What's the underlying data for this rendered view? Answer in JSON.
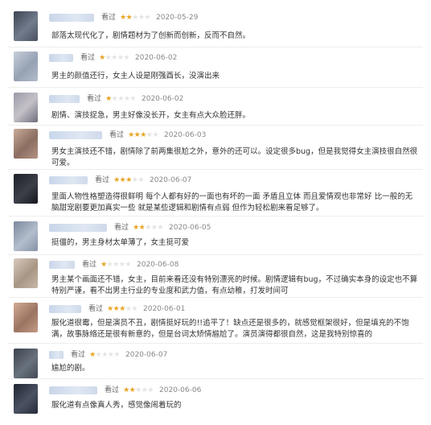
{
  "seen_label": "看过",
  "reviews": [
    {
      "rating": 2,
      "date": "2020-05-29",
      "text": "部落太现代化了，剧情题材为了创新而创新，反而不自然。",
      "avatar_color": "#5f6674"
    },
    {
      "rating": 1,
      "date": "2020-06-02",
      "text": "男主的颜值还行，女主人设是刚强酉长，没演出来",
      "avatar_color": "#a9b3c2"
    },
    {
      "rating": 1,
      "date": "2020-06-02",
      "text": "剧情、演技捉急，男主好像没长开，女主有点大众脸还胖。",
      "avatar_color": "#8c8b95"
    },
    {
      "rating": 3,
      "date": "2020-06-03",
      "text": "男女主演技还不错，剧情除了前两集很尬之外，意外的还可以。设定很多bug，但是我觉得女主演技很自然很可爱。",
      "avatar_color": "#a68a7c"
    },
    {
      "rating": 3,
      "date": "2020-06-07",
      "text": "里面人物性格塑造得很鲜明 每个人都有好的一面也有坏的一面 矛盾且立体 而且爱情观也非常好 比一般的无脑甜宠剧要更加真实一些 就是某些逻辑和剧情有点弱 但作为轻松剧来看足够了。",
      "avatar_color": "#2a2c33"
    },
    {
      "rating": 2,
      "date": "2020-06-05",
      "text": "挺僵的，男主身材太单薄了，女主挺可爱",
      "avatar_color": "#8e9aae"
    },
    {
      "rating": 1,
      "date": "2020-06-08",
      "text": "男主某个画面还不错，女主，目前来看还没有特别漂亮的时候。剧情逻辑有bug，不过确实本身的设定也不算特别严谨，看不出男主行业的专业度和武力值，有点幼稚，打发时间可",
      "avatar_color": "#c4b6a6"
    },
    {
      "rating": 3,
      "date": "2020-06-01",
      "text": "服化道很霉，但是演员不丑，剧情挺好玩的!!追平了！缺点还是很多的，就感觉框架很好，但是填充的不饱满，故事脉络还是很有新意的，但是台词太矫情尴尬了。演员演得都很自然，这是我特别惊喜的",
      "avatar_color": "#b58f7c"
    },
    {
      "rating": 1,
      "date": "2020-06-07",
      "text": "尴尬的剧。",
      "avatar_color": "#4d5561"
    },
    {
      "rating": 2,
      "date": "2020-06-06",
      "text": "服化道有点像真人秀，感觉像闹着玩的",
      "avatar_color": "#2e3341"
    }
  ]
}
